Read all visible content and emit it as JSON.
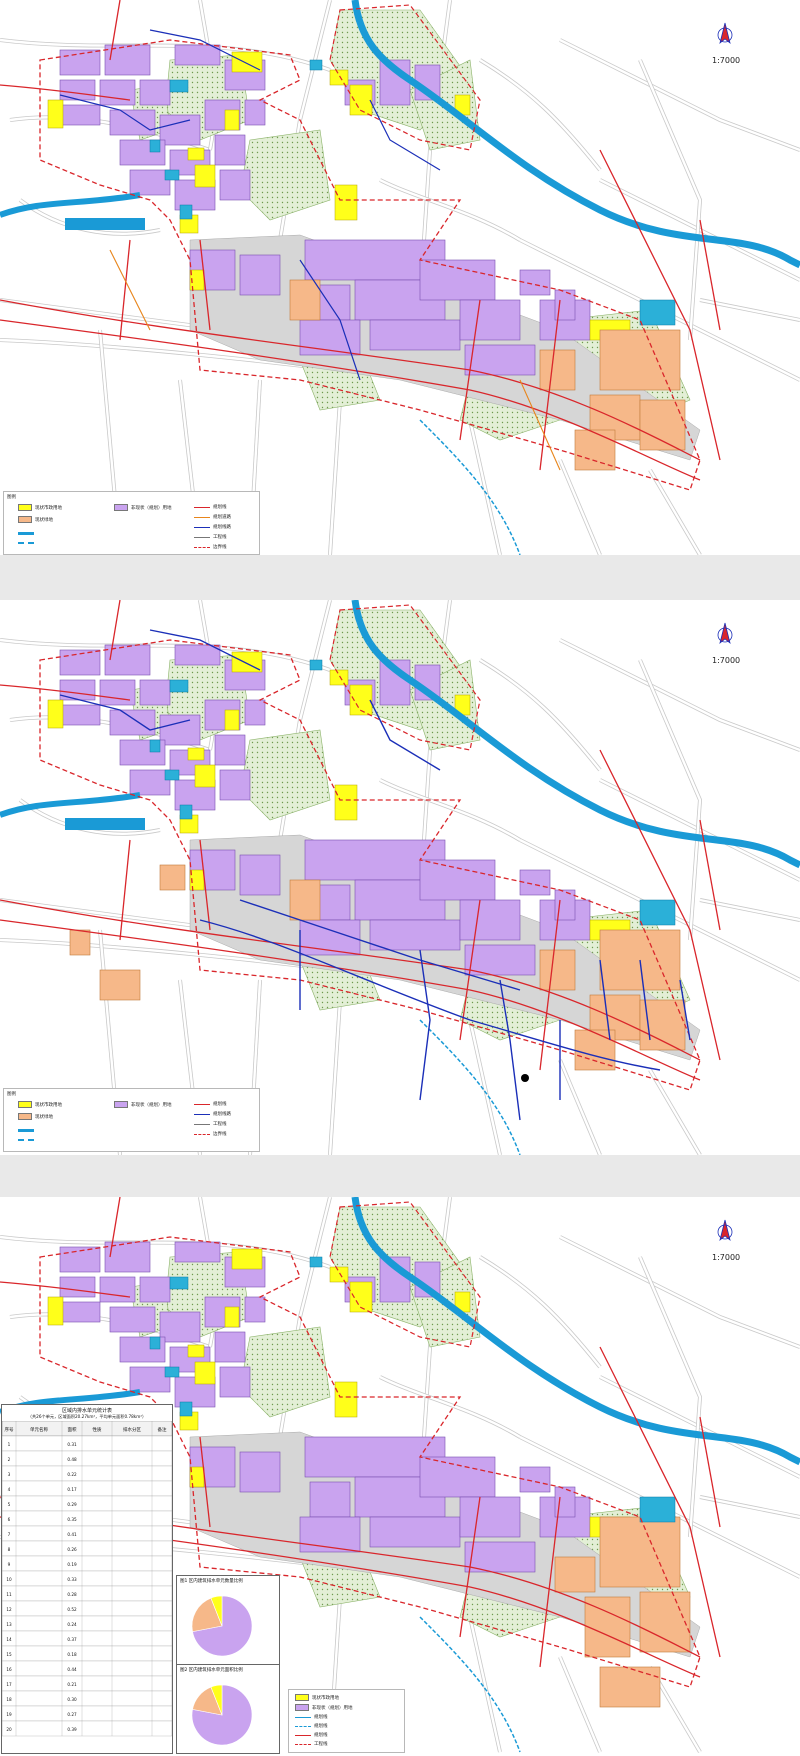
{
  "maps": [
    {
      "scale": "1:7000"
    },
    {
      "scale": "1:7000"
    },
    {
      "scale": "1:7000"
    }
  ],
  "legend1": {
    "title": "图例",
    "items": [
      "现状市政用地",
      "非现状（规划）用地",
      "现状绿地",
      "规划线",
      "规划道路",
      "规划线路",
      "工程线",
      "边界线"
    ]
  },
  "legend3": {
    "items": [
      "现状市政用地",
      "非现状（规划）用地",
      "规划线",
      "规划线",
      "规划线",
      "工程线"
    ]
  },
  "table": {
    "title": "区域内排水单元统计表",
    "subtitle": "（共26个单元，区域面积20.27km²，平均单元面积0.78km²）",
    "columns": [
      "序号",
      "单元名称",
      "面积",
      "性质",
      "排水分区",
      "备注"
    ],
    "rows": [
      [
        "1",
        "",
        "0.31",
        "",
        "",
        ""
      ],
      [
        "2",
        "",
        "0.48",
        "",
        "",
        ""
      ],
      [
        "3",
        "",
        "0.22",
        "",
        "",
        ""
      ],
      [
        "4",
        "",
        "0.17",
        "",
        "",
        ""
      ],
      [
        "5",
        "",
        "0.29",
        "",
        "",
        ""
      ],
      [
        "6",
        "",
        "0.35",
        "",
        "",
        ""
      ],
      [
        "7",
        "",
        "0.41",
        "",
        "",
        ""
      ],
      [
        "8",
        "",
        "0.26",
        "",
        "",
        ""
      ],
      [
        "9",
        "",
        "0.19",
        "",
        "",
        ""
      ],
      [
        "10",
        "",
        "0.33",
        "",
        "",
        ""
      ],
      [
        "11",
        "",
        "0.28",
        "",
        "",
        ""
      ],
      [
        "12",
        "",
        "0.52",
        "",
        "",
        ""
      ],
      [
        "13",
        "",
        "0.24",
        "",
        "",
        ""
      ],
      [
        "14",
        "",
        "0.37",
        "",
        "",
        ""
      ],
      [
        "15",
        "",
        "0.18",
        "",
        "",
        ""
      ],
      [
        "16",
        "",
        "0.44",
        "",
        "",
        ""
      ],
      [
        "17",
        "",
        "0.21",
        "",
        "",
        ""
      ],
      [
        "18",
        "",
        "0.30",
        "",
        "",
        ""
      ],
      [
        "19",
        "",
        "0.27",
        "",
        "",
        ""
      ],
      [
        "20",
        "",
        "0.39",
        "",
        "",
        ""
      ]
    ]
  },
  "charts": [
    {
      "title": "图1 区内建筑排水单元数量比例",
      "type": "pie",
      "slices": [
        0.72,
        0.22,
        0.06
      ],
      "labels": [
        "",
        "",
        ""
      ]
    },
    {
      "title": "图2 区内建筑排水单元面积比例",
      "type": "pie",
      "slices": [
        0.78,
        0.16,
        0.06
      ],
      "labels": [
        "",
        "",
        ""
      ]
    }
  ],
  "colors": {
    "purple": "#c9a3ef",
    "yellow": "#ffff1a",
    "orange": "#f6b889",
    "green": "#e3efd6",
    "blue": "#1a9ad6",
    "cyan": "#2bb0d8",
    "red": "#d9262b",
    "darkblue": "#1b2fb8",
    "gray": "#d6d6d6"
  }
}
